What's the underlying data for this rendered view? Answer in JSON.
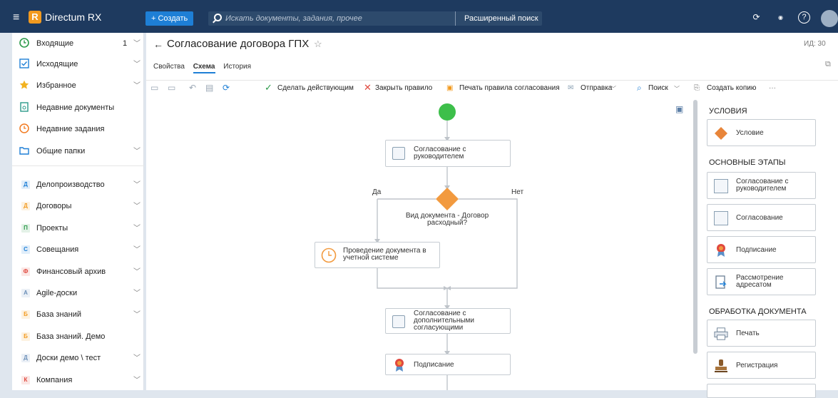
{
  "topbar": {
    "brand": "Directum RX",
    "create_label": "+ Создать",
    "search_placeholder": "Искать документы, задания, прочее",
    "advanced_search": "Расширенный поиск",
    "icons": [
      "menu-icon",
      "refresh-sync-icon",
      "new-badge-icon",
      "help-icon",
      "avatar"
    ]
  },
  "sidebar": {
    "items": [
      {
        "label": "Входящие",
        "count": "1",
        "icon": "clock-icon"
      },
      {
        "label": "Исходящие",
        "icon": "check-box-icon"
      },
      {
        "label": "Избранное",
        "icon": "star-icon"
      },
      {
        "label": "Недавние документы",
        "icon": "document-icon"
      },
      {
        "label": "Недавние задания",
        "icon": "history-icon"
      },
      {
        "label": "Общие папки",
        "icon": "folder-icon"
      }
    ],
    "modules": [
      {
        "label": "Делопроизводство",
        "badge": "Д",
        "color": "#1e7fd6"
      },
      {
        "label": "Договоры",
        "badge": "Д",
        "color": "#f29a1f"
      },
      {
        "label": "Проекты",
        "badge": "П",
        "color": "#2c9a4a"
      },
      {
        "label": "Совещания",
        "badge": "С",
        "color": "#1e7fd6"
      },
      {
        "label": "Финансовый архив",
        "badge": "Ф",
        "color": "#e0483e"
      },
      {
        "label": "Agile-доски",
        "badge": "A",
        "color": "#6b8fb8"
      },
      {
        "label": "База знаний",
        "badge": "Б",
        "color": "#f29a1f"
      },
      {
        "label": "База знаний. Демо",
        "badge": "Б",
        "color": "#f29a1f"
      },
      {
        "label": "Доски демо \\ тест",
        "badge": "Д",
        "color": "#6b8fb8"
      },
      {
        "label": "Компания",
        "badge": "К",
        "color": "#e0483e"
      }
    ]
  },
  "main": {
    "title": "Согласование договора ГПХ",
    "id_label": "ИД: 30",
    "tabs": [
      "Свойства",
      "Схема",
      "История"
    ],
    "active_tab": "Схема",
    "toolbar": {
      "make_active": "Сделать действующим",
      "close_rule": "Закрыть правило",
      "print_rules": "Печать правила согласования",
      "send": "Отправка",
      "search": "Поиск",
      "copy": "Создать копию",
      "more": "···"
    }
  },
  "scheme": {
    "node_manager": "Согласование с\nруководителем",
    "decision_label": "Вид документа - Договор\nрасходный?",
    "yes": "Да",
    "no": "Нет",
    "node_accounting": "Проведение документа в\nучетной системе",
    "node_additional": "Согласование с\nдополнительными\nсогласующими",
    "node_signing": "Подписание"
  },
  "palette": {
    "conditions_head": "УСЛОВИЯ",
    "condition": "Условие",
    "main_stages_head": "ОСНОВНЫЕ ЭТАПЫ",
    "stage_manager": "Согласование с\nруководителем",
    "stage_approval": "Согласование",
    "stage_signing": "Подписание",
    "stage_review": "Рассмотрение\nадресатом",
    "processing_head": "ОБРАБОТКА ДОКУМЕНТА",
    "proc_print": "Печать",
    "proc_registration": "Регистрация"
  }
}
